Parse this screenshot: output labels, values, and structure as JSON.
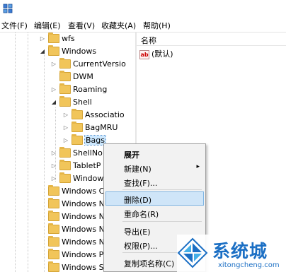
{
  "menubar": {
    "items": [
      "文件(F)",
      "编辑(E)",
      "查看(V)",
      "收藏夹(A)",
      "帮助(H)"
    ]
  },
  "tree": {
    "nodes": [
      {
        "label": "wfs",
        "expander": "collapsed"
      },
      {
        "label": "Windows",
        "expander": "expanded"
      },
      {
        "label": "CurrentVersio",
        "expander": "collapsed"
      },
      {
        "label": "DWM",
        "expander": "none"
      },
      {
        "label": "Roaming",
        "expander": "collapsed"
      },
      {
        "label": "Shell",
        "expander": "expanded"
      },
      {
        "label": "Associatio",
        "expander": "collapsed"
      },
      {
        "label": "BagMRU",
        "expander": "collapsed"
      },
      {
        "label": "Bags",
        "expander": "collapsed"
      },
      {
        "label": "ShellNo",
        "expander": "collapsed"
      },
      {
        "label": "TabletP",
        "expander": "collapsed"
      },
      {
        "label": "Window",
        "expander": "collapsed"
      },
      {
        "label": "Windows C",
        "expander": "none"
      },
      {
        "label": "Windows N",
        "expander": "none"
      },
      {
        "label": "Windows N",
        "expander": "none"
      },
      {
        "label": "Windows N",
        "expander": "none"
      },
      {
        "label": "Windows N",
        "expander": "none"
      },
      {
        "label": "Windows P",
        "expander": "none"
      },
      {
        "label": "Windows S",
        "expander": "none"
      }
    ]
  },
  "values": {
    "column_name": "名称",
    "rows": [
      {
        "icon": "ab",
        "name": "(默认)"
      }
    ]
  },
  "context_menu": {
    "items": [
      {
        "label": "展开",
        "bold": true
      },
      {
        "label": "新建(N)",
        "submenu": true
      },
      {
        "label": "查找(F)..."
      },
      {
        "label": "删除(D)",
        "highlighted": true
      },
      {
        "label": "重命名(R)"
      },
      {
        "label": "导出(E)"
      },
      {
        "label": "权限(P)..."
      },
      {
        "label": "复制项名称(C)"
      }
    ],
    "submenu_arrow": "▸"
  },
  "watermark": {
    "title": "系统城",
    "url": "xitongcheng.com"
  },
  "colors": {
    "selection": "#cce8ff",
    "highlight": "#cfe5f8",
    "folder": "#f1c55a",
    "brand": "#1b6fc4"
  },
  "icons": {
    "expander_collapsed": "▷",
    "expander_expanded": "◢"
  }
}
